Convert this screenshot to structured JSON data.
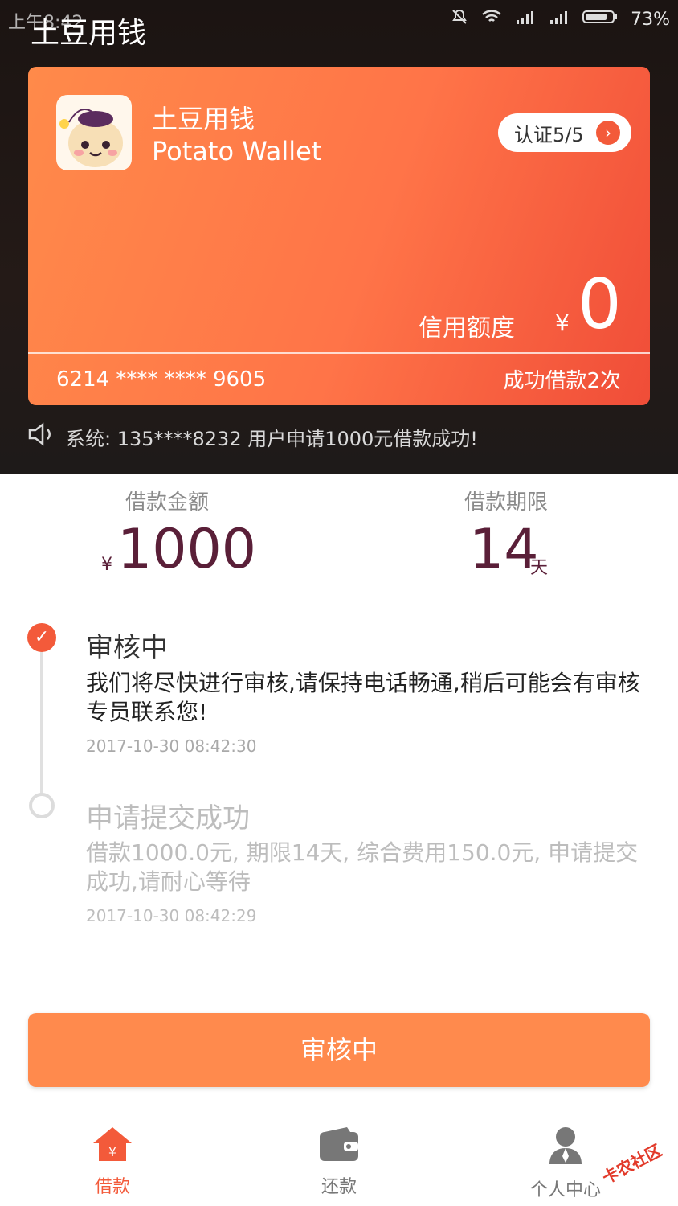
{
  "status_bar": {
    "time": "上午8:42",
    "battery": "73%"
  },
  "app_title": "土豆用钱",
  "card": {
    "name_cn": "土豆用钱",
    "name_en": "Potato Wallet",
    "cert_label": "认证5/5",
    "credit_label": "信用额度",
    "currency": "¥",
    "credit_value": "0",
    "card_number": "6214 **** **** 9605",
    "loan_count_text": "成功借款2次"
  },
  "notice": "系统: 135****8232 用户申请1000元借款成功!",
  "loan": {
    "amount_label": "借款金额",
    "amount_currency": "¥",
    "amount_value": "1000",
    "term_label": "借款期限",
    "term_value": "14",
    "term_unit": "天"
  },
  "timeline": [
    {
      "title": "审核中",
      "desc": "我们将尽快进行审核,请保持电话畅通,稍后可能会有审核专员联系您!",
      "time": "2017-10-30 08:42:30"
    },
    {
      "title": "申请提交成功",
      "desc": "借款1000.0元, 期限14天, 综合费用150.0元, 申请提交成功,请耐心等待",
      "time": "2017-10-30 08:42:29"
    }
  ],
  "main_button": "审核中",
  "tabs": [
    {
      "label": "借款",
      "icon": "home-yen-icon"
    },
    {
      "label": "还款",
      "icon": "wallet-icon"
    },
    {
      "label": "个人中心",
      "icon": "user-icon"
    }
  ],
  "watermark": "卡农社区",
  "colors": {
    "accent": "#f35a3a",
    "card_start": "#ff8a4a",
    "card_end": "#f04d38",
    "amount_text": "#5a1f38",
    "button": "#ff8a4d"
  }
}
